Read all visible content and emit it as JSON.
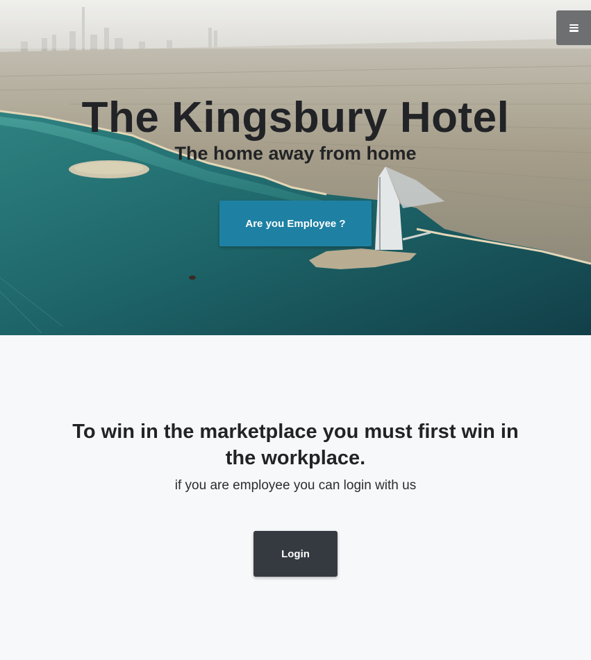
{
  "hero": {
    "title": "The Kingsbury Hotel",
    "subtitle": "The home away from home",
    "cta_label": "Are you Employee ?",
    "cta_color": "#1e81a4"
  },
  "nav": {
    "menu_icon": "hamburger-menu-icon"
  },
  "section": {
    "heading": "To win in the marketplace you must first win in the workplace.",
    "subheading": "if you are employee you can login with us",
    "login_label": "Login",
    "login_color": "#353a40"
  }
}
